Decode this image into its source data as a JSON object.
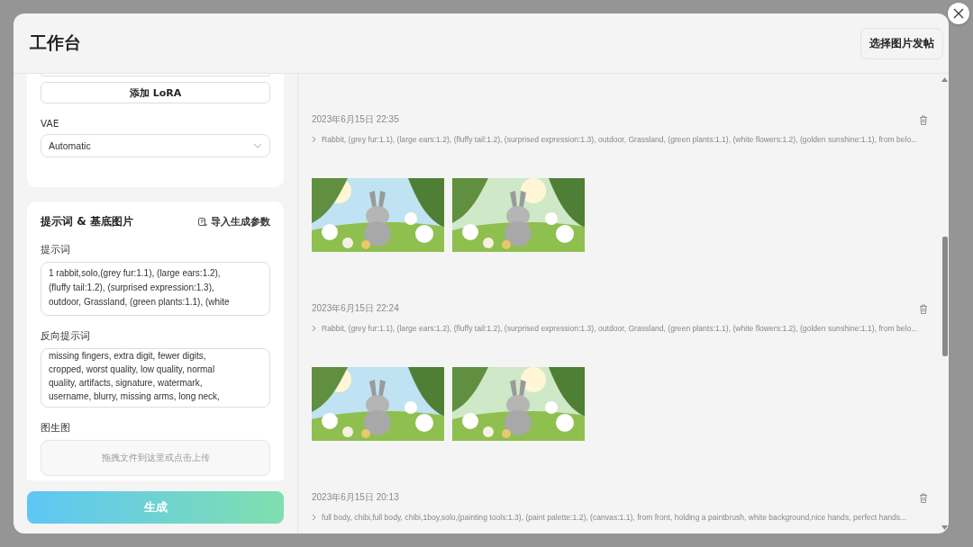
{
  "window": {
    "title": "工作台"
  },
  "header_button": "选择图片发帖",
  "lora_button": "添加 LoRA",
  "vae": {
    "label": "VAE",
    "value": "Automatic"
  },
  "prompt_section": {
    "title": "提示词 & 基底图片",
    "import_link": "导入生成参数",
    "prompt": {
      "label": "提示词",
      "value_lines": [
        "1 rabbit,solo,(grey fur:1.1), (large ears:1.2),",
        "(fluffy tail:1.2), (surprised expression:1.3),",
        "outdoor, Grassland, (green plants:1.1), (white"
      ]
    },
    "negative_prompt": {
      "label": "反向提示词",
      "value_lines": [
        "missing fingers, extra digit, fewer digits,",
        "cropped, worst quality, low quality, normal",
        "quality, artifacts, signature, watermark,",
        "username, blurry, missing arms, long neck,"
      ]
    },
    "img2img": {
      "label": "图生图",
      "placeholder": "拖拽文件到这里或点击上传"
    }
  },
  "generate_button": "生成",
  "history": [
    {
      "date": "2023年6月15日 22:35",
      "prompt": "Rabbit, (grey fur:1.1), (large ears:1.2), (fluffy tail:1.2), (surprised expression:1.3), outdoor, Grassland, (green plants:1.1), (white flowers:1.2), (golden sunshine:1.1), from belo..."
    },
    {
      "date": "2023年6月15日 22:24",
      "prompt": "Rabbit, (grey fur:1.1), (large ears:1.2), (fluffy tail:1.2), (surprised expression:1.3), outdoor, Grassland, (green plants:1.1), (white flowers:1.2), (golden sunshine:1.1), from belo..."
    },
    {
      "date": "2023年6月15日 20:13",
      "prompt": "full body, chibi,full body, chibi,1boy,solo,(painting tools:1.3), (paint palette:1.2), (canvas:1.1), from front, holding a paintbrush, white background,nice hands, perfect hands..."
    }
  ]
}
